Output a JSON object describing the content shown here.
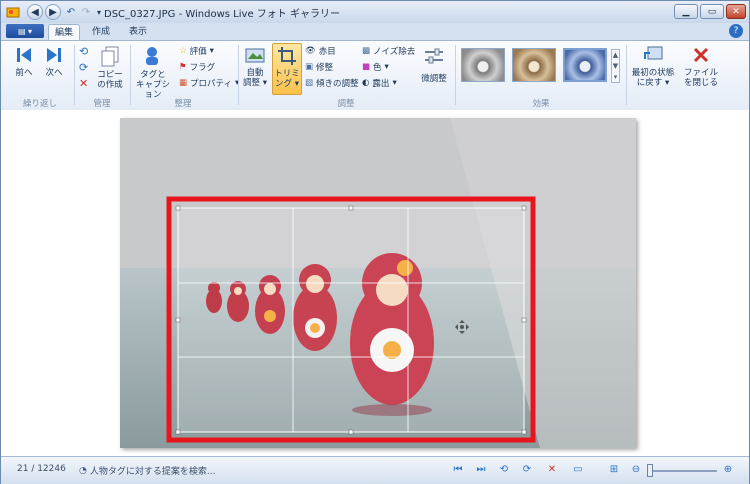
{
  "window": {
    "title": "DSC_0327.JPG - Windows Live フォト ギャラリー",
    "minimize_icon": "minimize-icon",
    "maximize_icon": "maximize-icon",
    "close_icon": "close-icon"
  },
  "tabs": {
    "app_menu_icon": "app-menu-icon",
    "edit": "編集",
    "create": "作成",
    "view": "表示"
  },
  "ribbon": {
    "undo_group": {
      "prev": "前へ",
      "next": "次へ",
      "label": "繰り返し"
    },
    "manage_group": {
      "copy": "コピー",
      "copy2": "の作成",
      "label": "管理"
    },
    "organize_group": {
      "tag": "タグと",
      "tag2": "キャプション",
      "rating": "評価",
      "flag": "フラグ",
      "properties": "プロパティ",
      "label": "整理"
    },
    "adjust_group": {
      "auto": "自動",
      "auto2": "調整",
      "trim": "トリミ",
      "trim2": "ング",
      "redeye": "赤目",
      "retouch": "修整",
      "straighten": "傾きの調整",
      "noise": "ノイズ除去",
      "color": "色",
      "exposure": "露出",
      "fine_tune": "微調整",
      "label": "調整"
    },
    "effects_group": {
      "label": "効果"
    },
    "revert": {
      "line1": "最初の状態",
      "line2": "に戻す"
    },
    "close_file": {
      "line1": "ファイル",
      "line2": "を閉じる"
    }
  },
  "status": {
    "count": "21 / 12246",
    "suggestion": "人物タグに対する提案を検索..."
  }
}
